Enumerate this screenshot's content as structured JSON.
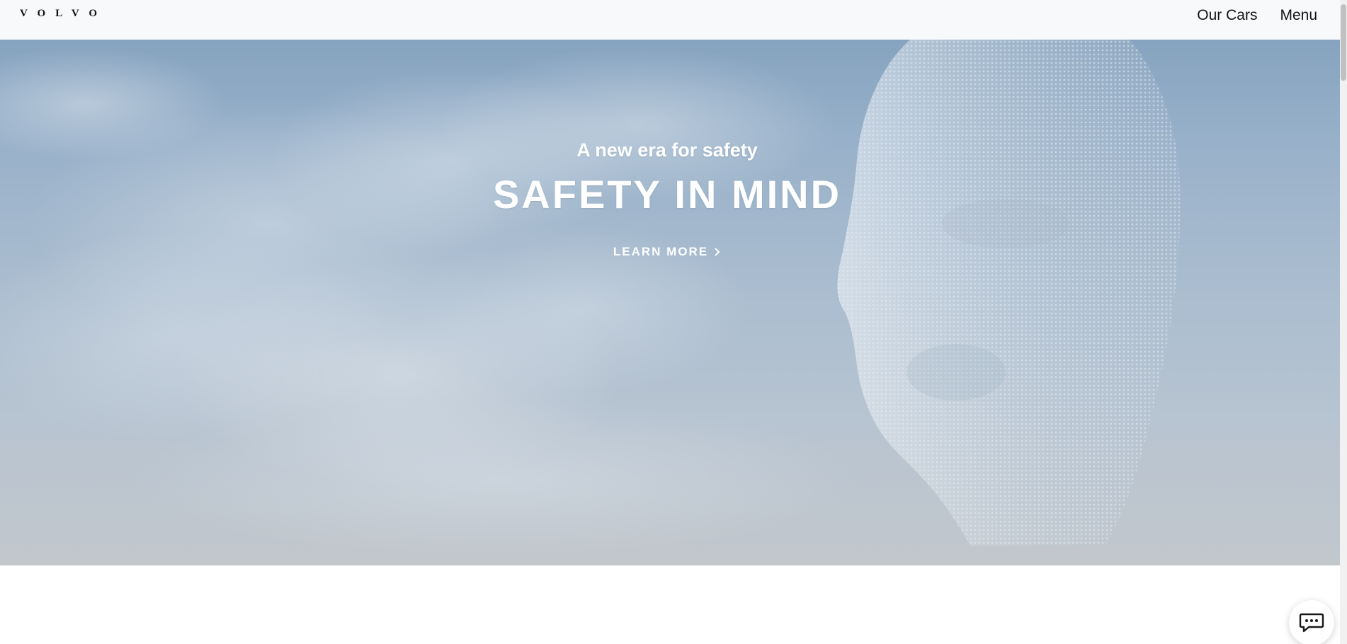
{
  "header": {
    "logo_text": "VOLVO",
    "nav": {
      "our_cars": "Our Cars",
      "menu": "Menu"
    }
  },
  "hero": {
    "kicker": "A new era for safety",
    "headline": "SAFETY IN MIND",
    "cta_label": "LEARN MORE",
    "cta_icon": "chevron-right-icon",
    "background": "sky-with-clouds-and-dot-matrix-face"
  },
  "widgets": {
    "chat_icon": "chat-bubble-icon"
  },
  "colors": {
    "sky_top": "#86a3bf",
    "sky_bottom": "#c2c7cc",
    "text_on_hero": "#ffffff",
    "nav_text": "#141414"
  }
}
